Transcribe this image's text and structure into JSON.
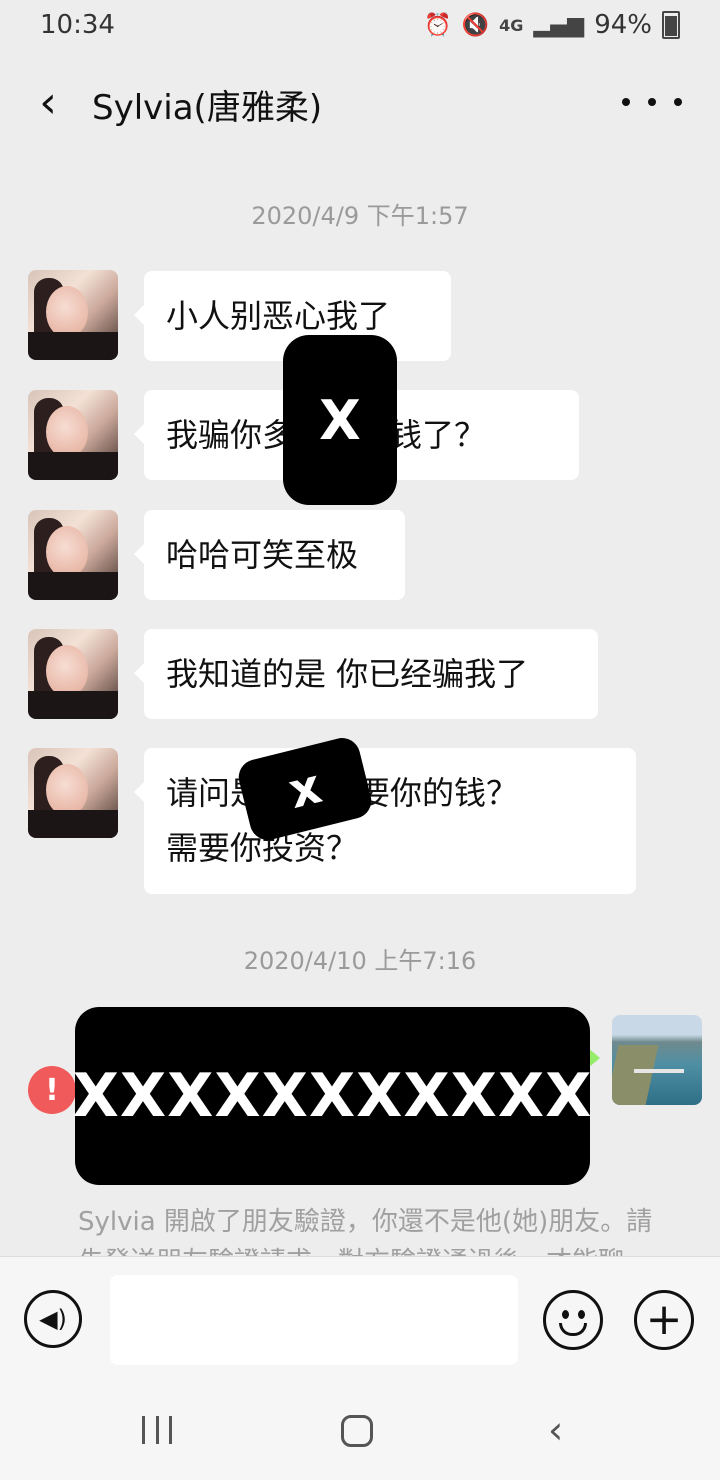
{
  "status_bar": {
    "time": "10:34",
    "network": "4G",
    "battery": "94%",
    "icons": [
      "alarm-icon",
      "mute-icon",
      "signal-icon",
      "battery-icon"
    ]
  },
  "header": {
    "title": "Sylvia(唐雅柔)",
    "back_icon": "back-arrow-icon",
    "more_icon": "more-icon"
  },
  "messages": {
    "timestamp_1": "2020/4/9 下午1:57",
    "m1": "小人别恶心我了",
    "m2": "我骗你多少一块钱了？",
    "m3": "哈哈可笑至极",
    "m4": "我知道的是 你已经骗我了",
    "m5_line1": "请问是谁我需要你的钱？",
    "m5_line2": "需要你投资？",
    "timestamp_2": "2020/4/10 上午7:16",
    "redact_1": "X",
    "redact_2": "x",
    "redact_3": "XXXXXXXXXXX",
    "error_mark": "!",
    "system_notice": "Sylvia 開啟了朋友驗證，你還不是他(她)朋友。請先發送朋友驗證請求，對方驗證通過後，才能聊天。"
  },
  "input_bar": {
    "placeholder": "",
    "voice_icon": "voice-icon",
    "emoji_icon": "emoji-icon",
    "plus_icon": "plus-icon",
    "plus_glyph": "+"
  },
  "nav_bar": {
    "icons": [
      "recent-apps-icon",
      "home-icon",
      "back-icon"
    ]
  },
  "colors": {
    "background": "#ededed",
    "bubble_received": "#ffffff",
    "bubble_sent": "#95ec69",
    "error": "#f05a5a"
  }
}
